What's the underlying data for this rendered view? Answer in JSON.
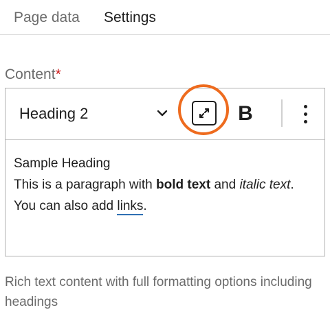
{
  "tabs": [
    {
      "label": "Page data",
      "active": false
    },
    {
      "label": "Settings",
      "active": true
    }
  ],
  "field": {
    "label": "Content",
    "required_mark": "*"
  },
  "toolbar": {
    "block_type": "Heading 2",
    "bold_label": "B",
    "icons": [
      "chevron-down-icon",
      "expand-icon",
      "more-vertical-icon"
    ]
  },
  "editor": {
    "heading": "Sample Heading",
    "para_start": "This is a paragraph with ",
    "bold_text": "bold text",
    "para_and": " and ",
    "italic_text": "italic text",
    "para_mid": ". You can also add ",
    "link_text": "links",
    "para_end": "."
  },
  "help_text": "Rich text content with full formatting options including headings",
  "colors": {
    "highlight": "#ee6b1e",
    "link_underline": "#2f6fb3",
    "required": "#cc1818"
  }
}
